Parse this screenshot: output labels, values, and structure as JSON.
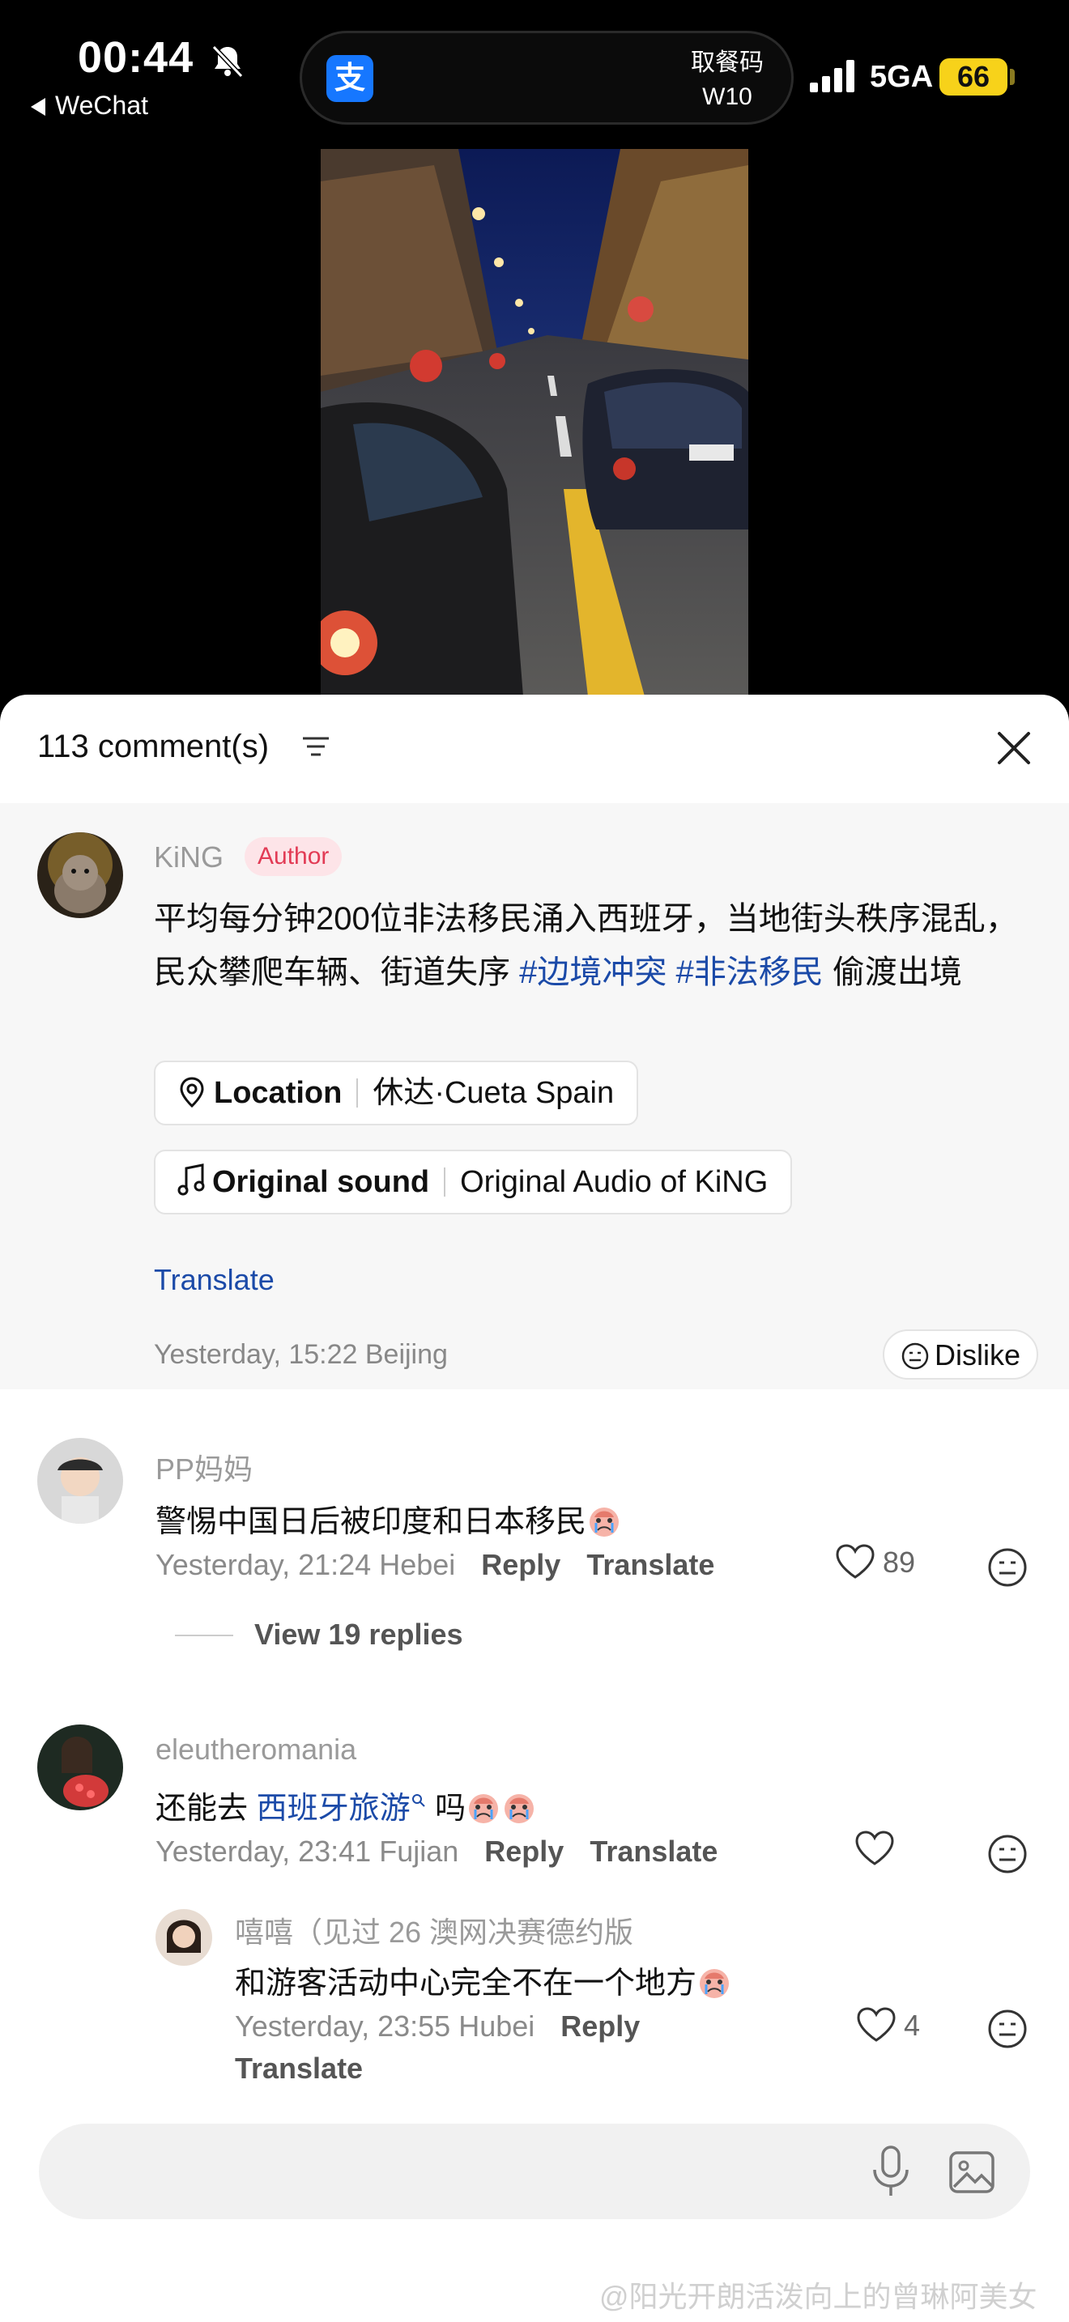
{
  "status_bar": {
    "time": "00:44",
    "back_app": "WeChat",
    "island_icon_char": "支",
    "island_title": "取餐码",
    "island_code": "W10",
    "network": "5GA",
    "battery": "66"
  },
  "comments_panel": {
    "count_label": "113 comment(s)",
    "author_post": {
      "name": "KiNG",
      "badge": "Author",
      "text_plain_1": "平均每分钟200位非法移民涌入西班牙，当地街头秩序混乱，民众攀爬车辆、街道失序 ",
      "tag_1": "#边境冲突",
      "tag_2": "#非法移民",
      "text_plain_2": " 偷渡出境",
      "location_key": "Location",
      "location_value": "休达·Cueta Spain",
      "sound_key": "Original sound",
      "sound_value": "Original Audio of KiNG",
      "translate": "Translate",
      "time": "Yesterday, 15:22 Beijing",
      "dislike": "Dislike"
    },
    "comments": [
      {
        "name": "PP妈妈",
        "text": "警惕中国日后被印度和日本移民",
        "time": "Yesterday, 21:24 Hebei",
        "reply": "Reply",
        "translate": "Translate",
        "likes": "89",
        "view_replies": "View 19 replies"
      },
      {
        "name": "eleutheromania",
        "text_before": "还能去 ",
        "link": "西班牙旅游",
        "text_after": " 吗",
        "time": "Yesterday, 23:41 Fujian",
        "reply": "Reply",
        "translate": "Translate",
        "likes": ""
      }
    ],
    "reply": {
      "name": "嘻嘻（见过 26 澳网决赛德约版",
      "text": "和游客活动中心完全不在一个地方",
      "time": "Yesterday, 23:55 Hubei",
      "reply": "Reply",
      "translate": "Translate",
      "likes": "4"
    }
  },
  "watermark": "@阳光开朗活泼向上的曾琳阿美女",
  "icons": [
    "bell-slash-icon",
    "alipay-icon",
    "signal-icon",
    "filter-icon",
    "close-icon",
    "location-pin-icon",
    "music-note-icon",
    "neutral-face-icon",
    "heart-icon",
    "crying-emoji-icon",
    "mic-icon",
    "image-icon"
  ],
  "colors": {
    "link": "#1b4aa8",
    "author_badge_bg": "#fde4e8",
    "author_badge_text": "#e23b55",
    "battery": "#f7d21a"
  }
}
